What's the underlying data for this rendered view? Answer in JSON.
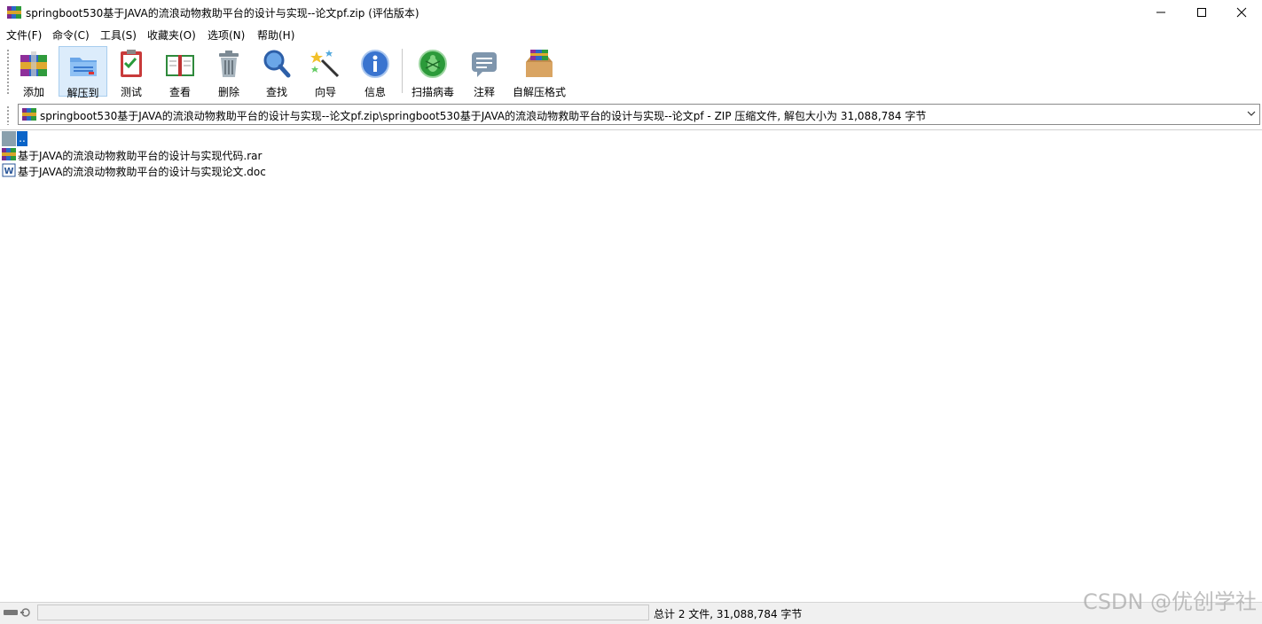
{
  "window": {
    "title": "springboot530基于JAVA的流浪动物救助平台的设计与实现--论文pf.zip (评估版本)",
    "controls": [
      "minimize",
      "maximize",
      "close"
    ]
  },
  "menu": {
    "items": [
      "文件(F)",
      "命令(C)",
      "工具(S)",
      "收藏夹(O)",
      "选项(N)",
      "帮助(H)"
    ]
  },
  "toolbar": {
    "buttons": [
      {
        "label": "添加",
        "icon": "add-archive-icon"
      },
      {
        "label": "解压到",
        "icon": "extract-to-icon",
        "active": true
      },
      {
        "label": "测试",
        "icon": "test-icon"
      },
      {
        "label": "查看",
        "icon": "view-icon"
      },
      {
        "label": "删除",
        "icon": "delete-icon"
      },
      {
        "label": "查找",
        "icon": "find-icon"
      },
      {
        "label": "向导",
        "icon": "wizard-icon"
      },
      {
        "label": "信息",
        "icon": "info-icon"
      },
      {
        "label": "扫描病毒",
        "icon": "virus-scan-icon"
      },
      {
        "label": "注释",
        "icon": "comment-icon"
      },
      {
        "label": "自解压格式",
        "icon": "sfx-icon"
      }
    ]
  },
  "address": {
    "text": "springboot530基于JAVA的流浪动物救助平台的设计与实现--论文pf.zip\\springboot530基于JAVA的流浪动物救助平台的设计与实现--论文pf - ZIP 压缩文件, 解包大小为 31,088,784 字节"
  },
  "files": {
    "parent": "..",
    "items": [
      {
        "name": "基于JAVA的流浪动物救助平台的设计与实现代码.rar",
        "icon": "rar-file-icon"
      },
      {
        "name": "基于JAVA的流浪动物救助平台的设计与实现论文.doc",
        "icon": "word-doc-icon"
      }
    ]
  },
  "status": {
    "summary": "总计 2 文件, 31,088,784 字节"
  },
  "watermark": "CSDN @优创学社"
}
